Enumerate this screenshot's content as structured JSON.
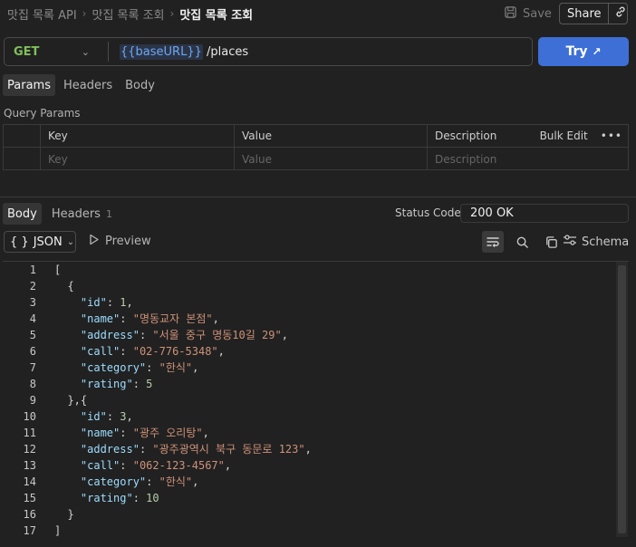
{
  "breadcrumb": {
    "root": "맛집 목록 API",
    "parent": "맛집 목록 조회",
    "current": "맛집 목록 조회"
  },
  "header": {
    "save_label": "Save",
    "share_label": "Share"
  },
  "request": {
    "method": "GET",
    "url_var": "{{baseURL}}",
    "url_path": " /places",
    "try_label": "Try"
  },
  "request_tabs": [
    "Params",
    "Headers",
    "Body"
  ],
  "query_params": {
    "title": "Query Params",
    "columns": [
      "Key",
      "Value",
      "Description"
    ],
    "placeholders": [
      "Key",
      "Value",
      "Description"
    ],
    "bulk_edit": "Bulk Edit"
  },
  "response": {
    "tabs": [
      {
        "label": "Body"
      },
      {
        "label": "Headers",
        "count": "1"
      }
    ],
    "status_label": "Status Code",
    "status_value": "200 OK",
    "format": "JSON",
    "format_icon": "{ }",
    "preview_label": "Preview",
    "schema_label": "Schema"
  },
  "code_lines": [
    [
      [
        "p",
        "["
      ]
    ],
    [
      [
        "p",
        "  {"
      ]
    ],
    [
      [
        "p",
        "    "
      ],
      [
        "k",
        "\"id\""
      ],
      [
        "p",
        ": "
      ],
      [
        "n",
        "1"
      ],
      [
        "p",
        ","
      ]
    ],
    [
      [
        "p",
        "    "
      ],
      [
        "k",
        "\"name\""
      ],
      [
        "p",
        ": "
      ],
      [
        "s",
        "\"명동교자 본점\""
      ],
      [
        "p",
        ","
      ]
    ],
    [
      [
        "p",
        "    "
      ],
      [
        "k",
        "\"address\""
      ],
      [
        "p",
        ": "
      ],
      [
        "s",
        "\"서울 중구 명동10길 29\""
      ],
      [
        "p",
        ","
      ]
    ],
    [
      [
        "p",
        "    "
      ],
      [
        "k",
        "\"call\""
      ],
      [
        "p",
        ": "
      ],
      [
        "s",
        "\"02-776-5348\""
      ],
      [
        "p",
        ","
      ]
    ],
    [
      [
        "p",
        "    "
      ],
      [
        "k",
        "\"category\""
      ],
      [
        "p",
        ": "
      ],
      [
        "s",
        "\"한식\""
      ],
      [
        "p",
        ","
      ]
    ],
    [
      [
        "p",
        "    "
      ],
      [
        "k",
        "\"rating\""
      ],
      [
        "p",
        ": "
      ],
      [
        "n",
        "5"
      ]
    ],
    [
      [
        "p",
        "  },{"
      ]
    ],
    [
      [
        "p",
        "    "
      ],
      [
        "k",
        "\"id\""
      ],
      [
        "p",
        ": "
      ],
      [
        "n",
        "3"
      ],
      [
        "p",
        ","
      ]
    ],
    [
      [
        "p",
        "    "
      ],
      [
        "k",
        "\"name\""
      ],
      [
        "p",
        ": "
      ],
      [
        "s",
        "\"광주 오리탕\""
      ],
      [
        "p",
        ","
      ]
    ],
    [
      [
        "p",
        "    "
      ],
      [
        "k",
        "\"address\""
      ],
      [
        "p",
        ": "
      ],
      [
        "s",
        "\"광주광역시 북구 동문로 123\""
      ],
      [
        "p",
        ","
      ]
    ],
    [
      [
        "p",
        "    "
      ],
      [
        "k",
        "\"call\""
      ],
      [
        "p",
        ": "
      ],
      [
        "s",
        "\"062-123-4567\""
      ],
      [
        "p",
        ","
      ]
    ],
    [
      [
        "p",
        "    "
      ],
      [
        "k",
        "\"category\""
      ],
      [
        "p",
        ": "
      ],
      [
        "s",
        "\"한식\""
      ],
      [
        "p",
        ","
      ]
    ],
    [
      [
        "p",
        "    "
      ],
      [
        "k",
        "\"rating\""
      ],
      [
        "p",
        ": "
      ],
      [
        "n",
        "10"
      ]
    ],
    [
      [
        "p",
        "  }"
      ]
    ],
    [
      [
        "p",
        "]"
      ]
    ]
  ]
}
